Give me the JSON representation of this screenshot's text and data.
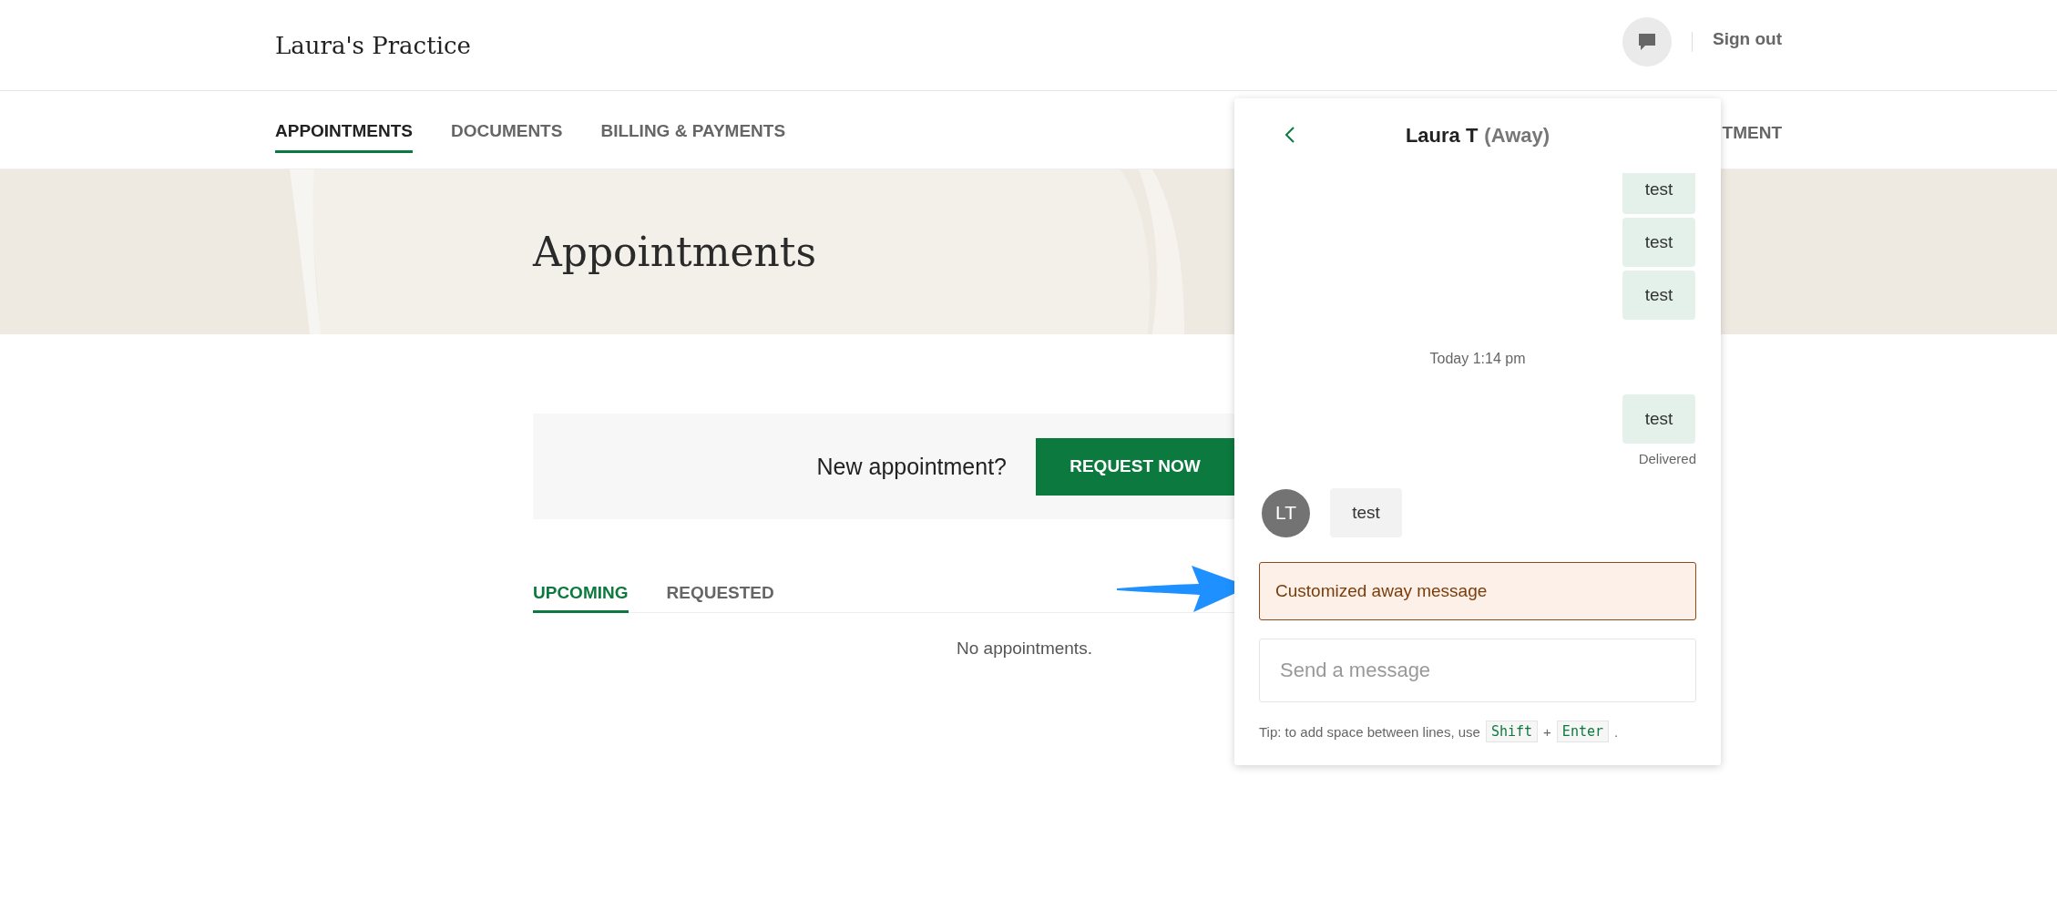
{
  "header": {
    "practice_name": "Laura's Practice",
    "sign_out": "Sign out"
  },
  "nav": {
    "items": [
      {
        "label": "APPOINTMENTS",
        "selected": true
      },
      {
        "label": "DOCUMENTS",
        "selected": false
      },
      {
        "label": "BILLING & PAYMENTS",
        "selected": false
      }
    ],
    "right_link": "TMENT"
  },
  "hero": {
    "title": "Appointments"
  },
  "request_card": {
    "prompt": "New appointment?",
    "button": "REQUEST NOW"
  },
  "tabs": [
    {
      "label": "UPCOMING",
      "selected": true
    },
    {
      "label": "REQUESTED",
      "selected": false
    }
  ],
  "empty_text": "No appointments.",
  "chat": {
    "contact": "Laura T",
    "status": "(Away)",
    "messages": [
      {
        "kind": "sent",
        "text": "test"
      },
      {
        "kind": "sent",
        "text": "test"
      },
      {
        "kind": "sent",
        "text": "test"
      },
      {
        "kind": "timestamp",
        "text": "Today 1:14 pm"
      },
      {
        "kind": "sent",
        "text": "test"
      },
      {
        "kind": "receipt",
        "text": "Delivered"
      },
      {
        "kind": "received",
        "avatar": "LT",
        "text": "test"
      }
    ],
    "away_message": "Customized away message",
    "input": {
      "placeholder": "Send a message"
    },
    "tip": [
      {
        "kind": "text",
        "text": "Tip: to add space between lines, use"
      },
      {
        "kind": "key",
        "text": "Shift"
      },
      {
        "kind": "text",
        "text": "+"
      },
      {
        "kind": "key",
        "text": "Enter"
      },
      {
        "kind": "text",
        "text": "."
      }
    ]
  }
}
